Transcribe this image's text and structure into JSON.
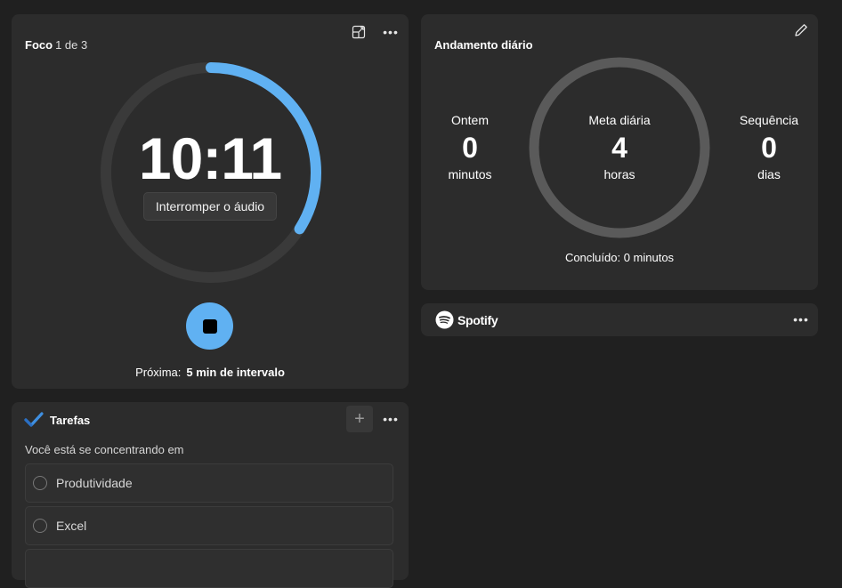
{
  "colors": {
    "background": "#202020",
    "card": "#2c2c2c",
    "accent_blue": "#60b1f2",
    "ring_track": "#3a3a3a",
    "daily_ring": "#5a5a5a"
  },
  "focus": {
    "title": "Foco",
    "session_counter": "1 de 3",
    "time": "10:11",
    "audio_button": "Interromper o áudio",
    "progress_fraction": 0.34,
    "next_label": "Próxima:",
    "next_value": "5 min de intervalo",
    "icons": [
      "compact-overlay-icon",
      "more-icon",
      "stop-icon"
    ]
  },
  "daily": {
    "title": "Andamento diário",
    "yesterday": {
      "label": "Ontem",
      "value": "0",
      "unit": "minutos"
    },
    "goal": {
      "label": "Meta diária",
      "value": "4",
      "unit": "horas"
    },
    "streak": {
      "label": "Sequência",
      "value": "0",
      "unit": "dias"
    },
    "completed": "Concluído: 0 minutos",
    "progress_fraction": 0,
    "icons": [
      "edit-icon"
    ]
  },
  "spotify": {
    "brand": "Spotify",
    "icons": [
      "spotify-logo-icon",
      "more-icon"
    ]
  },
  "tasks": {
    "title": "Tarefas",
    "hint": "Você está se concentrando em",
    "add_label": "+",
    "items": [
      {
        "label": "Produtividade"
      },
      {
        "label": "Excel"
      }
    ],
    "icons": [
      "todo-check-icon",
      "add-icon",
      "more-icon"
    ]
  }
}
